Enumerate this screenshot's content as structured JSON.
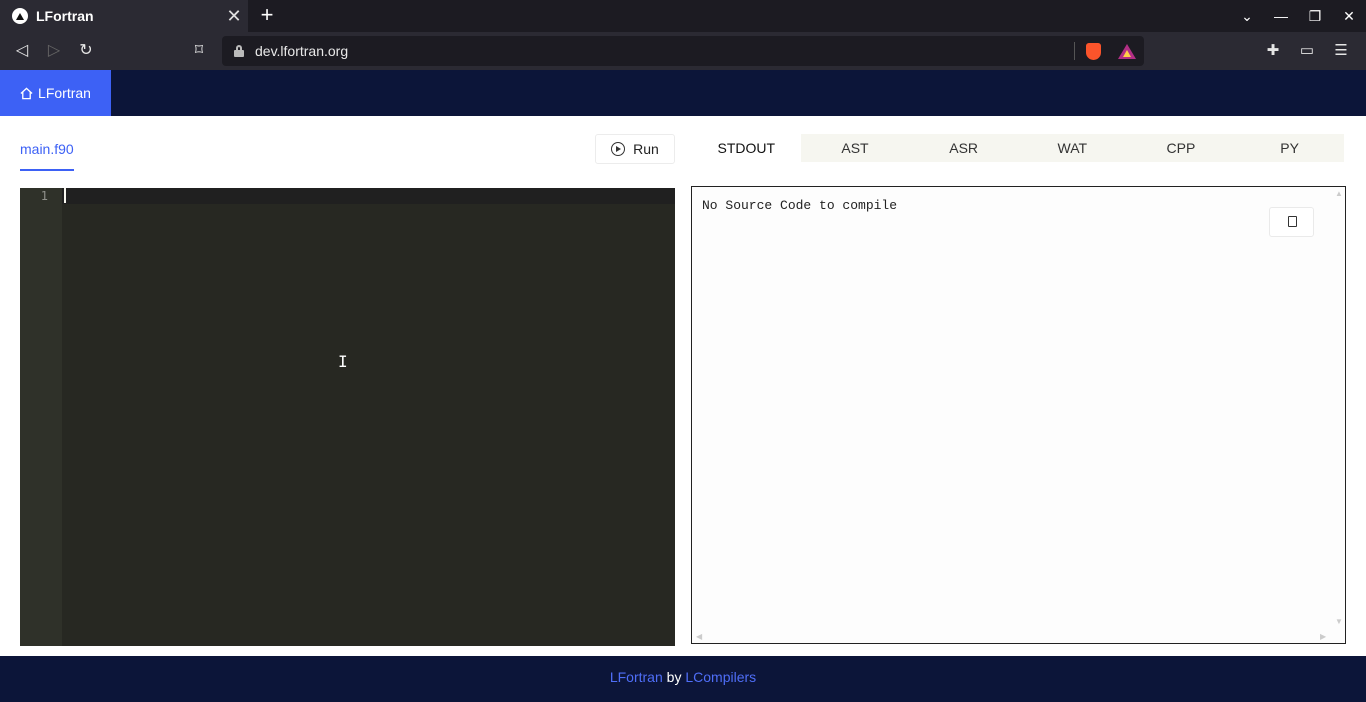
{
  "browser": {
    "tab_title": "LFortran",
    "tab_close": "✕",
    "new_tab": "+",
    "url": "dev.lfortran.org",
    "window_controls": {
      "minimize": "—",
      "restore": "❐",
      "close": "✕"
    },
    "icons": [
      "back-icon",
      "forward-icon",
      "reload-icon",
      "bookmark-icon",
      "lock-icon",
      "brave-shields-icon",
      "brave-rewards-icon",
      "extensions-icon",
      "wallet-icon",
      "menu-icon"
    ]
  },
  "header": {
    "home_label": "LFortran"
  },
  "editor": {
    "file_tab": "main.f90",
    "run_label": "Run",
    "line_numbers": [
      "1"
    ]
  },
  "output": {
    "tabs": [
      "STDOUT",
      "AST",
      "ASR",
      "WAT",
      "CPP",
      "PY"
    ],
    "active_tab": "STDOUT",
    "text": "No Source Code to compile"
  },
  "footer": {
    "project": "LFortran",
    "by": "by",
    "org": "LCompilers"
  },
  "colors": {
    "accent": "#3d61f5",
    "header_bg": "#0c1539",
    "editor_bg": "#272822"
  }
}
